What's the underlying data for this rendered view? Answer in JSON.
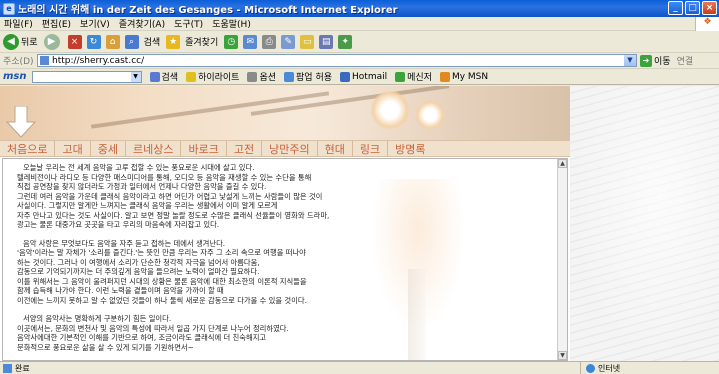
{
  "window": {
    "title": "노래의 시간 위해 in der Zeit des Gesanges - Microsoft Internet Explorer",
    "controls": [
      "_",
      "□",
      "×"
    ]
  },
  "menu": [
    "파일(F)",
    "편집(E)",
    "보기(V)",
    "즐겨찾기(A)",
    "도구(T)",
    "도움말(H)"
  ],
  "toolbar": {
    "back_label": "뒤로",
    "search_label": "검색",
    "favorites_label": "즐겨찾기"
  },
  "address": {
    "label": "주소(D)",
    "url": "http://sherry.cast.cc/",
    "go_label": "이동",
    "links_label": "연결"
  },
  "msn": {
    "logo": "msn",
    "search_label": "검색",
    "highlight_label": "하이라이트",
    "options_label": "옵션",
    "popup_label": "팝업 허용",
    "hotmail_label": "Hotmail",
    "messenger_label": "메신저",
    "mymsn_label": "My MSN"
  },
  "nav": [
    "처음으로",
    "고대",
    "중세",
    "르네상스",
    "바로크",
    "고전",
    "낭만주의",
    "현대",
    "링크",
    "방명록"
  ],
  "article": {
    "p1": [
      "오늘날 우리는 전 세계 음악을 고루 접할 수 있는 풍요로운 시대에 살고 있다.",
      "텔레비전이나 라디오 등 다양한 매스미디어를 통해, 오디오 등 음악을 재생할 수 있는 수단을 통해",
      "직접 공연장을 찾지 않더라도 가정과 일터에서 언제나 다양한 음악을 즐길 수 있다.",
      "그런데 여러 음악을 가운데 클래식 음악이라고 하면 어딘가 어렵고 낯설게 느끼는 사람들이 많은 것이",
      "사실이다. 그렇지만 알게만 느껴지는 클래식 음악을 우리는 생활에서 이미 알게 모르게",
      "자주 만나고 있다는 것도 사실이다. 알고 보면 정말 놀랄 정도로 수많은 클래식 선율들이 영화와 드라마,",
      "광고는 물론 대중가요 곳곳을 타고 우리의 마음속에 자리잡고 있다."
    ],
    "p2": [
      "음악 사랑은 무엇보다도 음악을 자주 듣고 접하는 데에서 생겨난다.",
      "'음악'이라는 말 자체가 '소리를 즐긴다.'는 뜻인 만큼 우리는 자주 그 소리 속으로 여행을 떠나야",
      "하는 것이다. 그러나 이 여행에서 소리가 단순한 청각적 자극을 넘어서 아름다움,",
      "감동으로 기억되기까지는 더 주의깊게 음악을 들으려는 노력이 얼마간 필요하다.",
      "이를 위해서는 그 음악이 울려퍼지던 시대의 상황은 물론 음악에 대한 최소한의 이론적 지식들을",
      "함께 습득해 나가야 한다. 이런 노력을 곁들이며 음악을 가까이 할 때",
      "이전에는 느끼지 못하고 알 수 없었던 것들이 하나 둘씩 새로운 감동으로 다가올 수 있을 것이다."
    ],
    "p3": [
      "서양의 음악사는 명확하게 구분하기 힘든 일이다.",
      "이곳에서는, 문화의 변천사 및 음악의 특성에 따라서 일곱 가지 단계로 나누어 정리하였다.",
      "음악사에대한 기본적인 이해를 기반으로 하여, 조금이라도 클래식에 더 친숙해지고",
      "문화적으로 풍요로운 삶을 살 수 있게 되기를 기원하면서~"
    ]
  },
  "status": {
    "left": "완료",
    "zone": "인터넷"
  },
  "colors": {
    "titlebar": "#0a5fd8",
    "nav_text": "#c8603a",
    "nav_bg": "#f0e1cd"
  }
}
